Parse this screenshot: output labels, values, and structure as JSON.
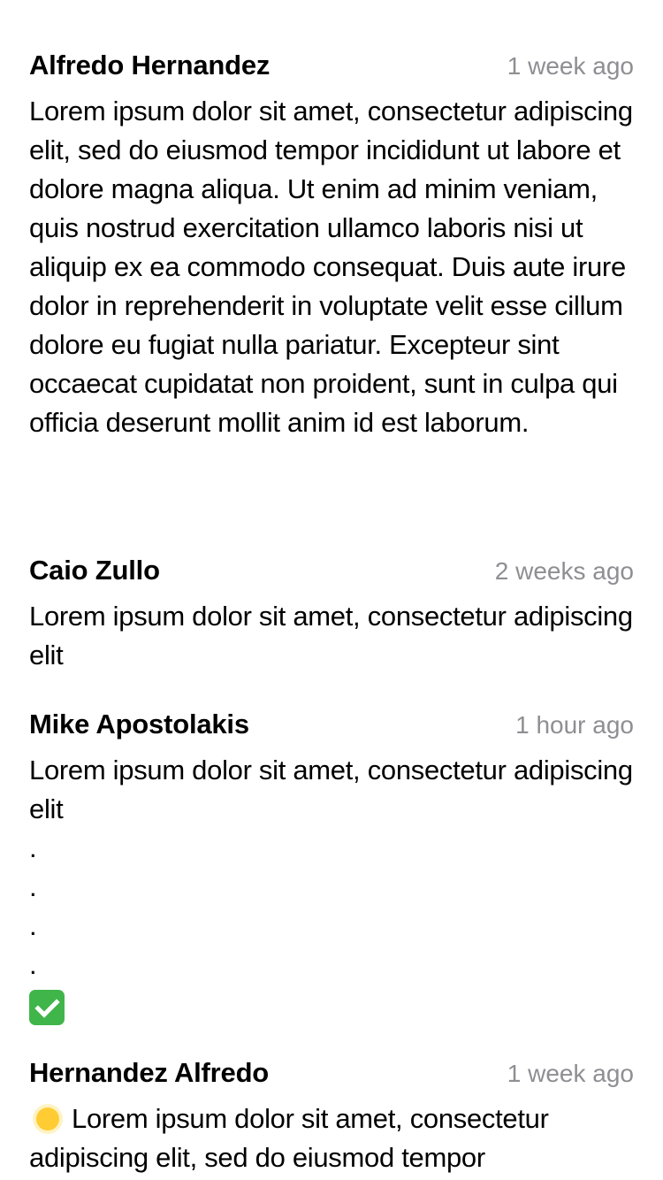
{
  "comments": [
    {
      "author": "Alfredo Hernandez",
      "time": "1 week ago",
      "text": "Lorem ipsum dolor sit amet, consectetur adipiscing elit, sed do eiusmod tempor incididunt ut labore et dolore magna aliqua. Ut enim ad minim veniam, quis nostrud exercitation ullamco laboris nisi ut aliquip ex ea commodo consequat. Duis aute irure dolor in reprehenderit in voluptate velit esse cillum dolore eu fugiat nulla pariatur. Excepteur sint occaecat cupidatat non proident, sunt in culpa qui officia deserunt mollit anim id est laborum."
    },
    {
      "author": "Caio Zullo",
      "time": "2 weeks ago",
      "text": "Lorem ipsum dolor sit amet, consectetur adipiscing elit"
    },
    {
      "author": "Mike Apostolakis",
      "time": "1 hour ago",
      "text": "Lorem ipsum dolor sit amet, consectetur adipiscing elit",
      "dots": [
        ".",
        ".",
        ".",
        "."
      ],
      "emoji_icon": "check-mark-button-icon"
    },
    {
      "author": "Hernandez Alfredo",
      "time": "1 week ago",
      "emoji_icon": "sun-icon",
      "text": "Lorem ipsum dolor sit amet, consectetur adipiscing elit, sed do eiusmod tempor"
    }
  ]
}
